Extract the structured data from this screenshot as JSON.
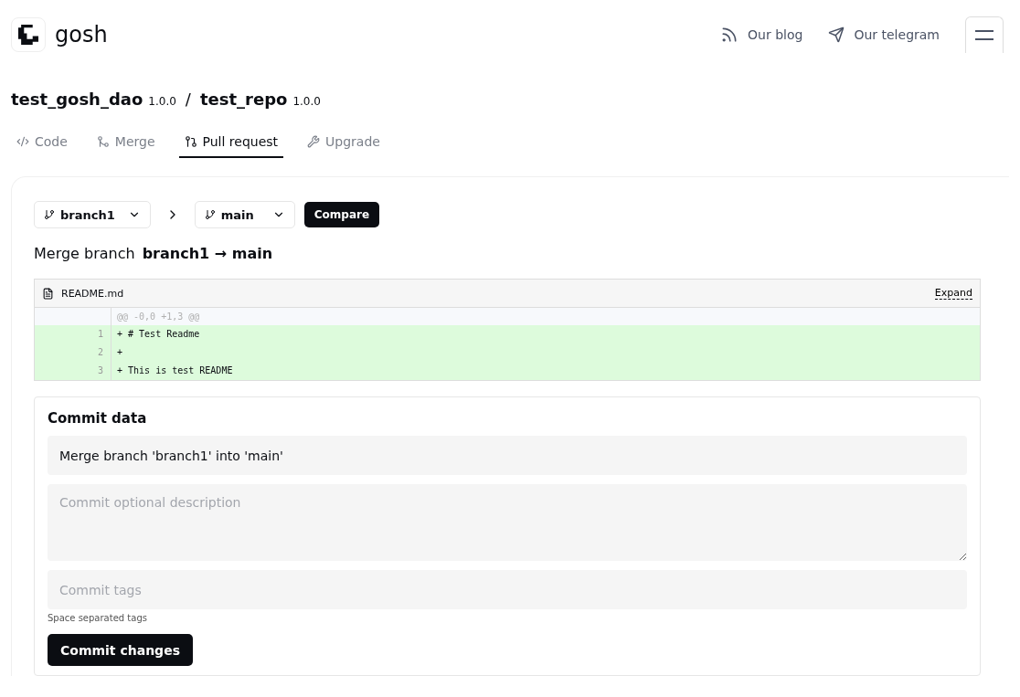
{
  "header": {
    "logo_text": "gosh",
    "links": [
      {
        "kind": "blog",
        "label": "Our blog"
      },
      {
        "kind": "telegram",
        "label": "Our telegram"
      }
    ]
  },
  "breadcrumb": {
    "dao": "test_gosh_dao",
    "dao_version": "1.0.0",
    "separator": "/",
    "repo": "test_repo",
    "repo_version": "1.0.0"
  },
  "tabs": [
    {
      "kind": "code",
      "label": "Code",
      "selected": false
    },
    {
      "kind": "merge",
      "label": "Merge",
      "selected": false
    },
    {
      "kind": "pull",
      "label": "Pull request",
      "selected": true
    },
    {
      "kind": "upgrade",
      "label": "Upgrade",
      "selected": false
    }
  ],
  "compare": {
    "source": "branch1",
    "target": "main",
    "button": "Compare"
  },
  "merge_title": {
    "prefix": "Merge branch",
    "branches": "branch1 → main"
  },
  "diff": {
    "file": "README.md",
    "expand": "Expand",
    "lines": [
      {
        "kind": "hunk",
        "text": "@@ -0,0 +1,3 @@"
      },
      {
        "kind": "added",
        "number": "1",
        "text": "+ # Test Readme"
      },
      {
        "kind": "added",
        "number": "2",
        "text": "+"
      },
      {
        "kind": "added",
        "number": "3",
        "text": "+ This is test README"
      }
    ]
  },
  "commit": {
    "title": "Commit data",
    "message": "Merge branch 'branch1' into 'main'",
    "description_placeholder": "Commit optional description",
    "tags_placeholder": "Commit tags",
    "tags_hint": "Space separated tags",
    "button": "Commit changes"
  }
}
